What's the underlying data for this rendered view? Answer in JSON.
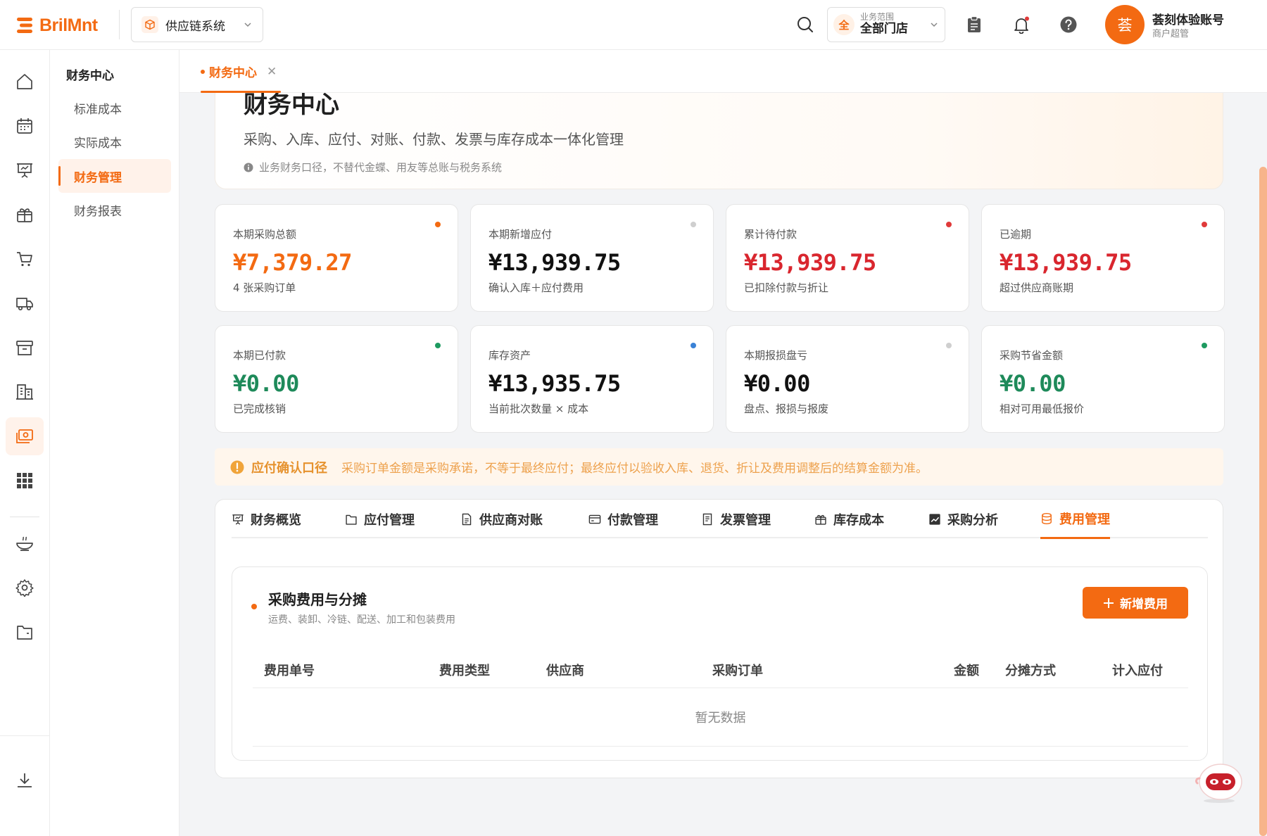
{
  "brand": {
    "name": "BrilMnt",
    "color": "#f36a12"
  },
  "header": {
    "system_select": {
      "label": "供应链系统",
      "icon": "package-icon"
    },
    "business_scope": {
      "badge": "全",
      "label": "业务范围",
      "value": "全部门店"
    },
    "user": {
      "avatar_text": "荟",
      "name": "荟刻体验账号",
      "role": "商户超管"
    }
  },
  "rail": {
    "items": [
      "home-icon",
      "calendar-icon",
      "presentation-icon",
      "gift-box-icon",
      "cart-icon",
      "truck-icon",
      "archive-icon",
      "building-icon",
      "finance-icon",
      "grid-icon",
      "dish-icon",
      "settings-icon",
      "folder-icon",
      "download-icon"
    ],
    "active": "finance-icon"
  },
  "subnav": {
    "title": "财务中心",
    "items": [
      {
        "label": "标准成本"
      },
      {
        "label": "实际成本"
      },
      {
        "label": "财务管理",
        "active": true
      },
      {
        "label": "财务报表"
      }
    ]
  },
  "page_tab": {
    "label": "财务中心"
  },
  "hero": {
    "title": "财务中心",
    "subtitle": "采购、入库、应付、对账、付款、发票与库存成本一体化管理",
    "note": "业务财务口径，不替代金蝶、用友等总账与税务系统"
  },
  "kpis": [
    {
      "label": "本期采购总额",
      "value": "¥7,379.27",
      "sub": "4 张采购订单",
      "color": "#f36a12",
      "dot": "#f36a12"
    },
    {
      "label": "本期新增应付",
      "value": "¥13,939.75",
      "sub": "确认入库＋应付费用",
      "color": "#111111",
      "dot": "#cfcfcf"
    },
    {
      "label": "累计待付款",
      "value": "¥13,939.75",
      "sub": "已扣除付款与折让",
      "color": "#d9262e",
      "dot": "#e03a3a"
    },
    {
      "label": "已逾期",
      "value": "¥13,939.75",
      "sub": "超过供应商账期",
      "color": "#d9262e",
      "dot": "#e03a3a"
    },
    {
      "label": "本期已付款",
      "value": "¥0.00",
      "sub": "已完成核销",
      "color": "#1e8a5a",
      "dot": "#1e9a60"
    },
    {
      "label": "库存资产",
      "value": "¥13,935.75",
      "sub": "当前批次数量 × 成本",
      "color": "#111111",
      "dot": "#3b82d6"
    },
    {
      "label": "本期报损盘亏",
      "value": "¥0.00",
      "sub": "盘点、报损与报废",
      "color": "#111111",
      "dot": "#cfcfcf"
    },
    {
      "label": "采购节省金额",
      "value": "¥0.00",
      "sub": "相对可用最低报价",
      "color": "#1e8a5a",
      "dot": "#1e9a60"
    }
  ],
  "notice": {
    "title": "应付确认口径",
    "text": "采购订单金额是采购承诺，不等于最终应付；最终应付以验收入库、退货、折让及费用调整后的结算金额为准。"
  },
  "function_tabs": [
    {
      "label": "财务概览",
      "icon": "presentation-icon"
    },
    {
      "label": "应付管理",
      "icon": "folder-icon"
    },
    {
      "label": "供应商对账",
      "icon": "document-icon"
    },
    {
      "label": "付款管理",
      "icon": "card-icon"
    },
    {
      "label": "发票管理",
      "icon": "receipt-icon"
    },
    {
      "label": "库存成本",
      "icon": "box-icon"
    },
    {
      "label": "采购分析",
      "icon": "chart-icon"
    },
    {
      "label": "费用管理",
      "icon": "database-icon",
      "active": true
    }
  ],
  "expense_card": {
    "title": "采购费用与分摊",
    "subtitle": "运费、装卸、冷链、配送、加工和包装费用",
    "add_button": "新增费用",
    "columns": [
      "费用单号",
      "费用类型",
      "供应商",
      "采购订单",
      "金额",
      "分摊方式",
      "计入应付"
    ],
    "empty_text": "暂无数据"
  }
}
